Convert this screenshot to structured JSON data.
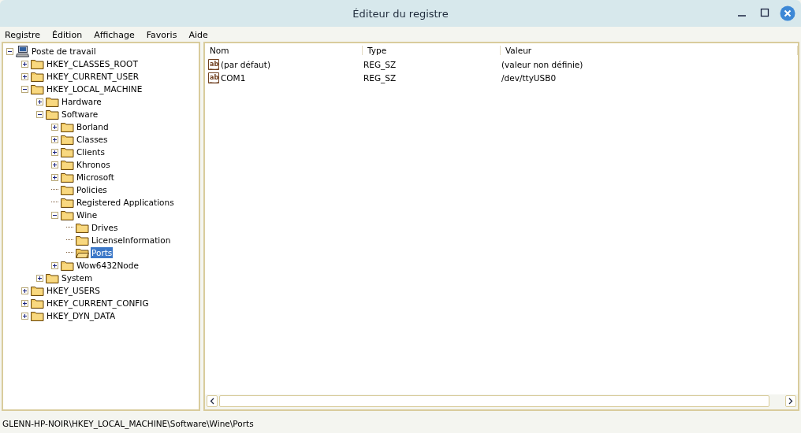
{
  "window": {
    "title": "Éditeur du registre"
  },
  "menu": [
    "Registre",
    "Édition",
    "Affichage",
    "Favoris",
    "Aide"
  ],
  "tree": [
    {
      "label": "Poste de travail",
      "kind": "computer",
      "expanded": true,
      "selected": false,
      "children": [
        {
          "label": "HKEY_CLASSES_ROOT",
          "kind": "folder",
          "expanded": false,
          "selected": false
        },
        {
          "label": "HKEY_CURRENT_USER",
          "kind": "folder",
          "expanded": false,
          "selected": false
        },
        {
          "label": "HKEY_LOCAL_MACHINE",
          "kind": "folder",
          "expanded": true,
          "selected": false,
          "children": [
            {
              "label": "Hardware",
              "kind": "folder",
              "expanded": false,
              "selected": false
            },
            {
              "label": "Software",
              "kind": "folder",
              "expanded": true,
              "selected": false,
              "children": [
                {
                  "label": "Borland",
                  "kind": "folder",
                  "expanded": false,
                  "selected": false
                },
                {
                  "label": "Classes",
                  "kind": "folder",
                  "expanded": false,
                  "selected": false
                },
                {
                  "label": "Clients",
                  "kind": "folder",
                  "expanded": false,
                  "selected": false
                },
                {
                  "label": "Khronos",
                  "kind": "folder",
                  "expanded": false,
                  "selected": false
                },
                {
                  "label": "Microsoft",
                  "kind": "folder",
                  "expanded": false,
                  "selected": false
                },
                {
                  "label": "Policies",
                  "kind": "folder",
                  "selected": false
                },
                {
                  "label": "Registered Applications",
                  "kind": "folder",
                  "selected": false
                },
                {
                  "label": "Wine",
                  "kind": "folder",
                  "expanded": true,
                  "selected": false,
                  "children": [
                    {
                      "label": "Drives",
                      "kind": "folder",
                      "selected": false
                    },
                    {
                      "label": "LicenseInformation",
                      "kind": "folder",
                      "selected": false
                    },
                    {
                      "label": "Ports",
                      "kind": "folder",
                      "selected": true
                    }
                  ]
                },
                {
                  "label": "Wow6432Node",
                  "kind": "folder",
                  "expanded": false,
                  "selected": false
                }
              ]
            },
            {
              "label": "System",
              "kind": "folder",
              "expanded": false,
              "selected": false
            }
          ]
        },
        {
          "label": "HKEY_USERS",
          "kind": "folder",
          "expanded": false,
          "selected": false
        },
        {
          "label": "HKEY_CURRENT_CONFIG",
          "kind": "folder",
          "expanded": false,
          "selected": false
        },
        {
          "label": "HKEY_DYN_DATA",
          "kind": "folder",
          "expanded": false,
          "selected": false
        }
      ]
    }
  ],
  "table": {
    "columns": [
      "Nom",
      "Type",
      "Valeur"
    ],
    "rows": [
      {
        "icon_text": "ab",
        "name": "(par défaut)",
        "type": "REG_SZ",
        "value": "(valeur non définie)"
      },
      {
        "icon_text": "ab",
        "name": "COM1",
        "type": "REG_SZ",
        "value": "/dev/ttyUSB0"
      }
    ]
  },
  "status_bar": "GLENN-HP-NOIR\\HKEY_LOCAL_MACHINE\\Software\\Wine\\Ports"
}
